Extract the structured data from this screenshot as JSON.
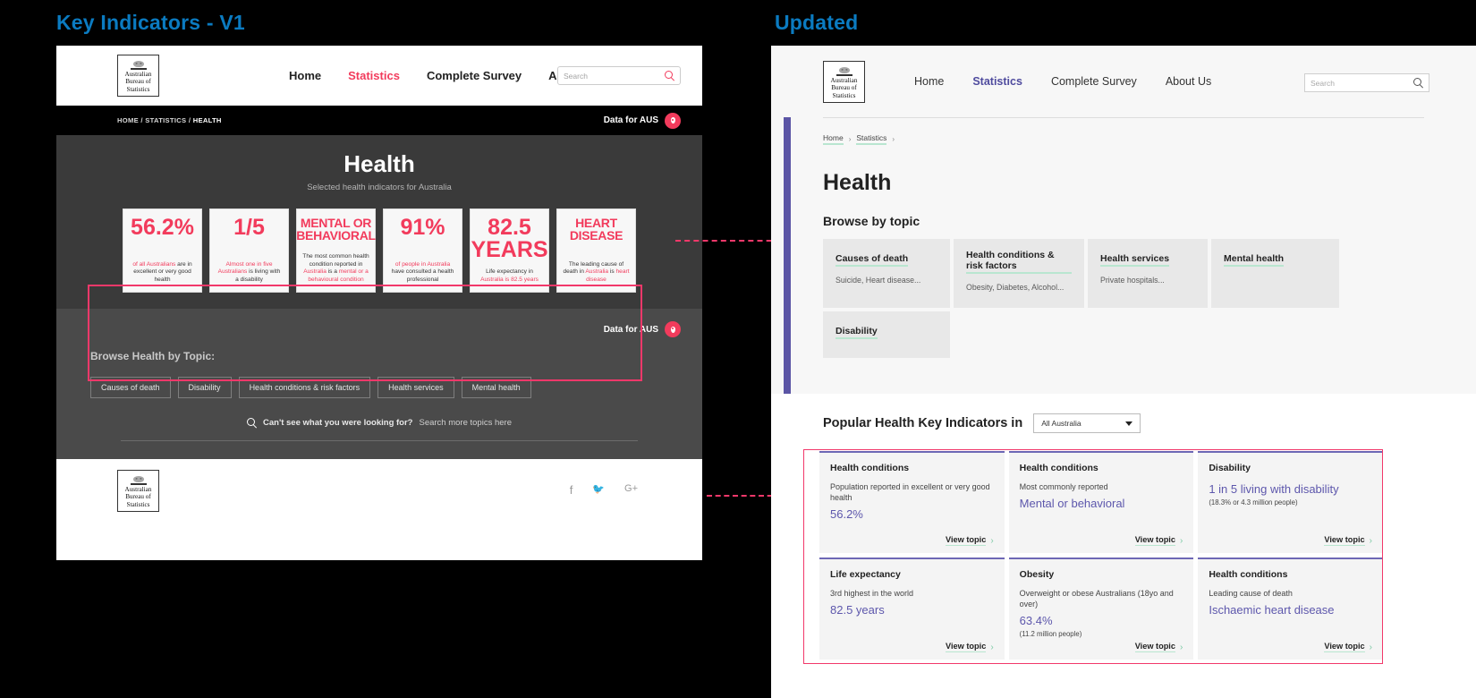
{
  "annotations": {
    "left_title": "Key Indicators - V1",
    "right_title": "Updated",
    "accent_blue": "#0b7bc1",
    "highlight_pink": "#f2386a"
  },
  "v1": {
    "brand": {
      "logo_line1": "Australian",
      "logo_line2": "Bureau of",
      "logo_line3": "Statistics"
    },
    "nav": [
      {
        "label": "Home",
        "active": false
      },
      {
        "label": "Statistics",
        "active": true
      },
      {
        "label": "Complete Survey",
        "active": false
      },
      {
        "label": "About Us",
        "active": false
      }
    ],
    "search": {
      "placeholder": "Search",
      "icon": "search-icon"
    },
    "breadcrumb": {
      "items": [
        "HOME",
        "STATISTICS"
      ],
      "current": "HEALTH",
      "separator": "/"
    },
    "data_for": {
      "label": "Data for AUS",
      "icon": "location-pin-icon"
    },
    "hero": {
      "title": "Health",
      "subtitle": "Selected health indicators for Australia"
    },
    "key_cards": [
      {
        "value": "56.2%",
        "value_style": "num",
        "desc_parts": [
          {
            "text": "of all Australians ",
            "accent": true
          },
          {
            "text": "are in excellent or very good health",
            "accent": false
          }
        ]
      },
      {
        "value": "1/5",
        "value_style": "num",
        "desc_parts": [
          {
            "text": "Almost one in five Australians ",
            "accent": true
          },
          {
            "text": "is living with a disability",
            "accent": false
          }
        ]
      },
      {
        "value": "MENTAL OR BEHAVIORAL",
        "value_style": "word",
        "desc_parts": [
          {
            "text": "The most common health condition reported in ",
            "accent": false
          },
          {
            "text": "Australia ",
            "accent": true
          },
          {
            "text": "is a ",
            "accent": false
          },
          {
            "text": "mental or a behavioural condition",
            "accent": true
          }
        ]
      },
      {
        "value": "91%",
        "value_style": "num",
        "desc_parts": [
          {
            "text": "of people in Australia ",
            "accent": true
          },
          {
            "text": "have consulted a health professional",
            "accent": false
          }
        ]
      },
      {
        "value": "82.5 YEARS",
        "value_style": "num",
        "desc_parts": [
          {
            "text": "Life expectancy in ",
            "accent": false
          },
          {
            "text": "Australia is 82.5 years",
            "accent": true
          }
        ]
      },
      {
        "value": "HEART DISEASE",
        "value_style": "word",
        "desc_parts": [
          {
            "text": "The leading cause of death in ",
            "accent": false
          },
          {
            "text": "Australia ",
            "accent": true
          },
          {
            "text": "is ",
            "accent": false
          },
          {
            "text": "heart disease",
            "accent": true
          }
        ]
      }
    ],
    "browse": {
      "data_for_label": "Data for AUS",
      "heading": "Browse Health by Topic:",
      "chips": [
        "Causes of death",
        "Disability",
        "Health conditions & risk factors",
        "Health services",
        "Mental health"
      ],
      "search_more_bold": "Can't see what you were looking for?",
      "search_more_light": "Search more topics here"
    },
    "footer": {
      "socials": [
        {
          "name": "facebook-icon",
          "glyph": "f"
        },
        {
          "name": "twitter-icon",
          "glyph": "✉"
        },
        {
          "name": "google-plus-icon",
          "glyph": "G+"
        }
      ]
    }
  },
  "updated": {
    "nav": [
      {
        "label": "Home",
        "active": false
      },
      {
        "label": "Statistics",
        "active": true
      },
      {
        "label": "Complete Survey",
        "active": false
      },
      {
        "label": "About Us",
        "active": false
      }
    ],
    "search": {
      "placeholder": "Search",
      "icon": "search-icon"
    },
    "breadcrumb": {
      "items": [
        "Home",
        "Statistics"
      ],
      "separator": "›"
    },
    "page_title": "Health",
    "browse_heading": "Browse by topic",
    "topics": [
      {
        "label": "Causes of death",
        "sub": "Suicide, Heart disease..."
      },
      {
        "label": "Health conditions & risk factors",
        "sub": "Obesity, Diabetes, Alcohol..."
      },
      {
        "label": "Health services",
        "sub": "Private hospitals..."
      },
      {
        "label": "Mental health",
        "sub": ""
      },
      {
        "label": "Disability",
        "sub": ""
      }
    ],
    "popular_heading": "Popular Health Key Indicators in",
    "region_select": {
      "value": "All Australia",
      "icon": "chevron-down-icon"
    },
    "indicator_cards": [
      {
        "topic": "Health conditions",
        "desc": "Population reported in excellent or very good health",
        "value": "56.2%",
        "note": "",
        "cta": "View topic"
      },
      {
        "topic": "Health conditions",
        "desc": "Most commonly reported",
        "value": "Mental or behavioral",
        "note": "",
        "cta": "View topic"
      },
      {
        "topic": "Disability",
        "desc": "",
        "value": "1 in 5 living with disability",
        "note": "(18.3% or 4.3 million people)",
        "cta": "View topic"
      },
      {
        "topic": "Life expectancy",
        "desc": "3rd highest in the world",
        "value": "82.5 years",
        "note": "",
        "cta": "View topic"
      },
      {
        "topic": "Obesity",
        "desc": "Overweight or obese Australians (18yo and over)",
        "value": "63.4%",
        "note": "(11.2 million people)",
        "cta": "View topic"
      },
      {
        "topic": "Health conditions",
        "desc": "Leading cause of death",
        "value": "Ischaemic heart disease",
        "note": "",
        "cta": "View topic"
      }
    ],
    "colors": {
      "accent_purple": "#5d57ac",
      "underline_mint": "#b9e6d0",
      "sidebar_purple": "#5b55a5"
    }
  }
}
